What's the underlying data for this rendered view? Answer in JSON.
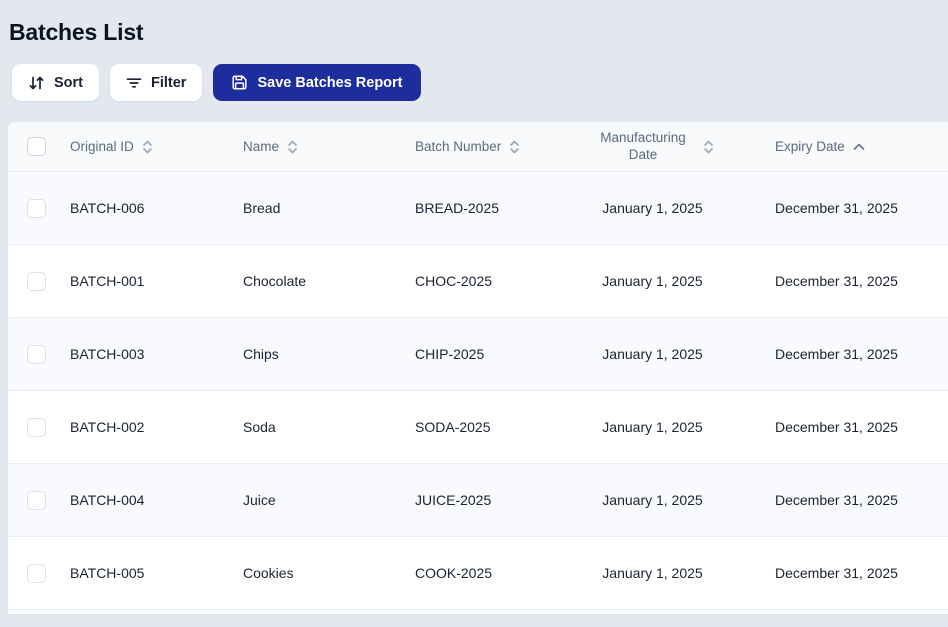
{
  "page": {
    "title": "Batches List",
    "background_color": "#e3e8ef",
    "accent_color": "#1d2d9e"
  },
  "toolbar": {
    "sort_label": "Sort",
    "filter_label": "Filter",
    "save_label": "Save Batches Report",
    "icons": {
      "sort": "arrows-up-down-icon",
      "filter": "filter-lines-icon",
      "save": "floppy-disk-icon"
    }
  },
  "table": {
    "columns": [
      {
        "label": "Original ID",
        "sort_state": "unsorted"
      },
      {
        "label": "Name",
        "sort_state": "unsorted"
      },
      {
        "label": "Batch Number",
        "sort_state": "unsorted"
      },
      {
        "label": "Manufacturing Date",
        "sort_state": "unsorted"
      },
      {
        "label": "Expiry Date",
        "sort_state": "ascending"
      }
    ],
    "rows": [
      {
        "original_id": "BATCH-006",
        "name": "Bread",
        "batch_number": "BREAD-2025",
        "manufacturing_date": "January 1, 2025",
        "expiry_date": "December 31, 2025"
      },
      {
        "original_id": "BATCH-001",
        "name": "Chocolate",
        "batch_number": "CHOC-2025",
        "manufacturing_date": "January 1, 2025",
        "expiry_date": "December 31, 2025"
      },
      {
        "original_id": "BATCH-003",
        "name": "Chips",
        "batch_number": "CHIP-2025",
        "manufacturing_date": "January 1, 2025",
        "expiry_date": "December 31, 2025"
      },
      {
        "original_id": "BATCH-002",
        "name": "Soda",
        "batch_number": "SODA-2025",
        "manufacturing_date": "January 1, 2025",
        "expiry_date": "December 31, 2025"
      },
      {
        "original_id": "BATCH-004",
        "name": "Juice",
        "batch_number": "JUICE-2025",
        "manufacturing_date": "January 1, 2025",
        "expiry_date": "December 31, 2025"
      },
      {
        "original_id": "BATCH-005",
        "name": "Cookies",
        "batch_number": "COOK-2025",
        "manufacturing_date": "January 1, 2025",
        "expiry_date": "December 31, 2025"
      }
    ]
  }
}
